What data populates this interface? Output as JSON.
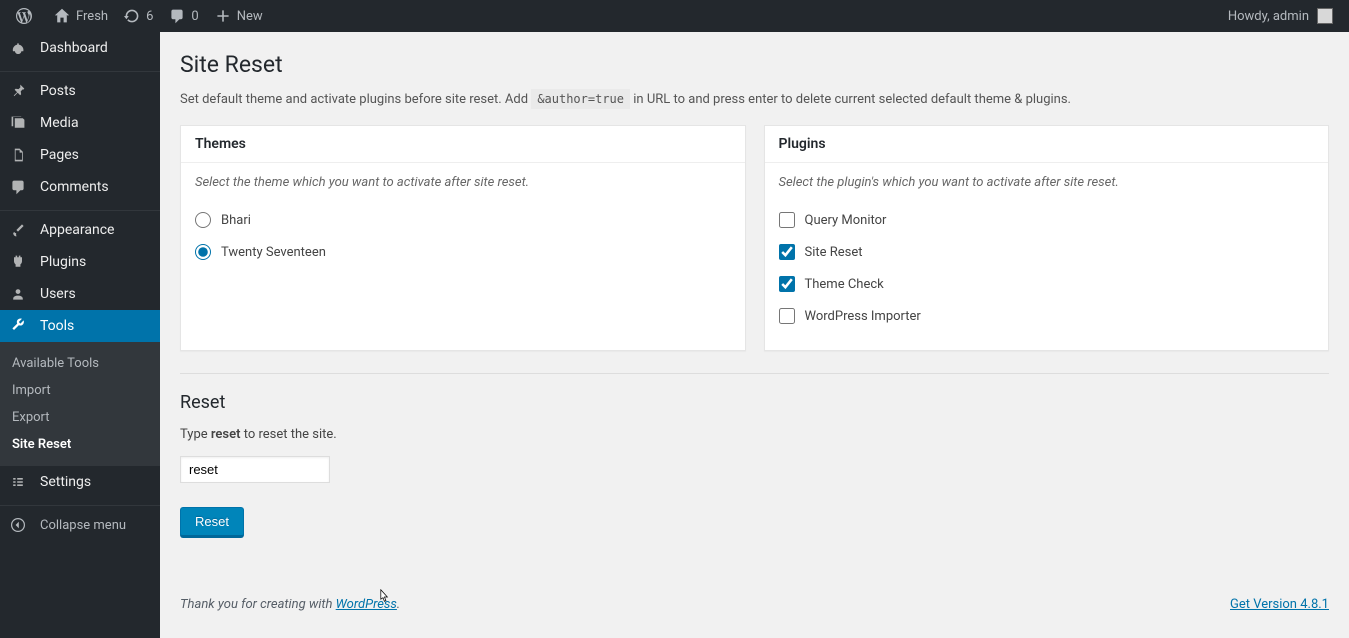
{
  "adminbar": {
    "site_name": "Fresh",
    "updates_count": "6",
    "comments_count": "0",
    "new_label": "New",
    "howdy": "Howdy, admin"
  },
  "sidebar": {
    "items": [
      {
        "label": "Dashboard"
      },
      {
        "label": "Posts"
      },
      {
        "label": "Media"
      },
      {
        "label": "Pages"
      },
      {
        "label": "Comments"
      },
      {
        "label": "Appearance"
      },
      {
        "label": "Plugins"
      },
      {
        "label": "Users"
      },
      {
        "label": "Tools"
      },
      {
        "label": "Settings"
      }
    ],
    "tools_submenu": [
      {
        "label": "Available Tools"
      },
      {
        "label": "Import"
      },
      {
        "label": "Export"
      },
      {
        "label": "Site Reset"
      }
    ],
    "collapse_label": "Collapse menu"
  },
  "page": {
    "title": "Site Reset",
    "help_before": "Set default theme and activate plugins before site reset. Add ",
    "help_code": "&author=true",
    "help_after": " in URL to and press enter to delete current selected default theme & plugins.",
    "themes_box": {
      "title": "Themes",
      "desc": "Select the theme which you want to activate after site reset.",
      "options": [
        {
          "label": "Bhari",
          "checked": false
        },
        {
          "label": "Twenty Seventeen",
          "checked": true
        }
      ]
    },
    "plugins_box": {
      "title": "Plugins",
      "desc": "Select the plugin's which you want to activate after site reset.",
      "options": [
        {
          "label": "Query Monitor",
          "checked": false
        },
        {
          "label": "Site Reset",
          "checked": true
        },
        {
          "label": "Theme Check",
          "checked": true
        },
        {
          "label": "WordPress Importer",
          "checked": false
        }
      ]
    },
    "reset": {
      "title": "Reset",
      "desc_before": "Type ",
      "kw": "reset",
      "desc_after": " to reset the site.",
      "input_value": "reset",
      "button": "Reset"
    },
    "footer": {
      "thanks_before": "Thank you for creating with ",
      "link": "WordPress",
      "thanks_after": ".",
      "version": "Get Version 4.8.1"
    }
  }
}
